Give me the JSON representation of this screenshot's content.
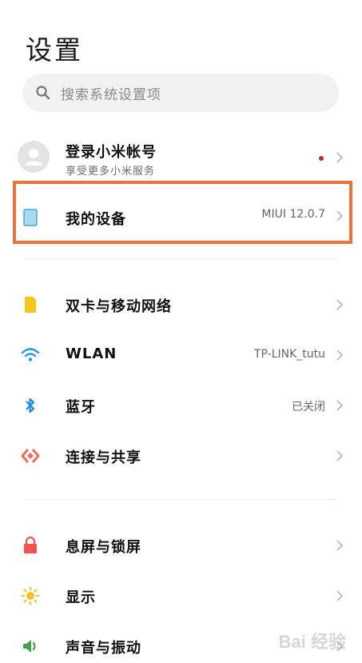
{
  "header": {
    "title": "设置"
  },
  "search": {
    "placeholder": "搜索系统设置项"
  },
  "account": {
    "title": "登录小米帐号",
    "subtitle": "享受更多小米服务",
    "has_notification": true
  },
  "device": {
    "label": "我的设备",
    "value": "MIUI 12.0.7",
    "highlighted": true,
    "highlight_color": "#e8743b"
  },
  "section1": [
    {
      "label": "双卡与移动网络",
      "value": "",
      "icon": "sim-card-icon",
      "color": "#f5c518"
    },
    {
      "label": "WLAN",
      "value": "TP-LINK_tutu",
      "icon": "wifi-icon",
      "color": "#1e9bd7"
    },
    {
      "label": "蓝牙",
      "value": "已关闭",
      "icon": "bluetooth-icon",
      "color": "#1e88e5"
    },
    {
      "label": "连接与共享",
      "value": "",
      "icon": "share-icon",
      "color": "#ef6c57"
    }
  ],
  "section2": [
    {
      "label": "息屏与锁屏",
      "value": "",
      "icon": "lock-icon",
      "color": "#ef5350"
    },
    {
      "label": "显示",
      "value": "",
      "icon": "sun-icon",
      "color": "#fbc02d"
    },
    {
      "label": "声音与振动",
      "value": "",
      "icon": "speaker-icon",
      "color": "#43a047"
    }
  ],
  "watermark": {
    "text": "Bai 经验"
  }
}
